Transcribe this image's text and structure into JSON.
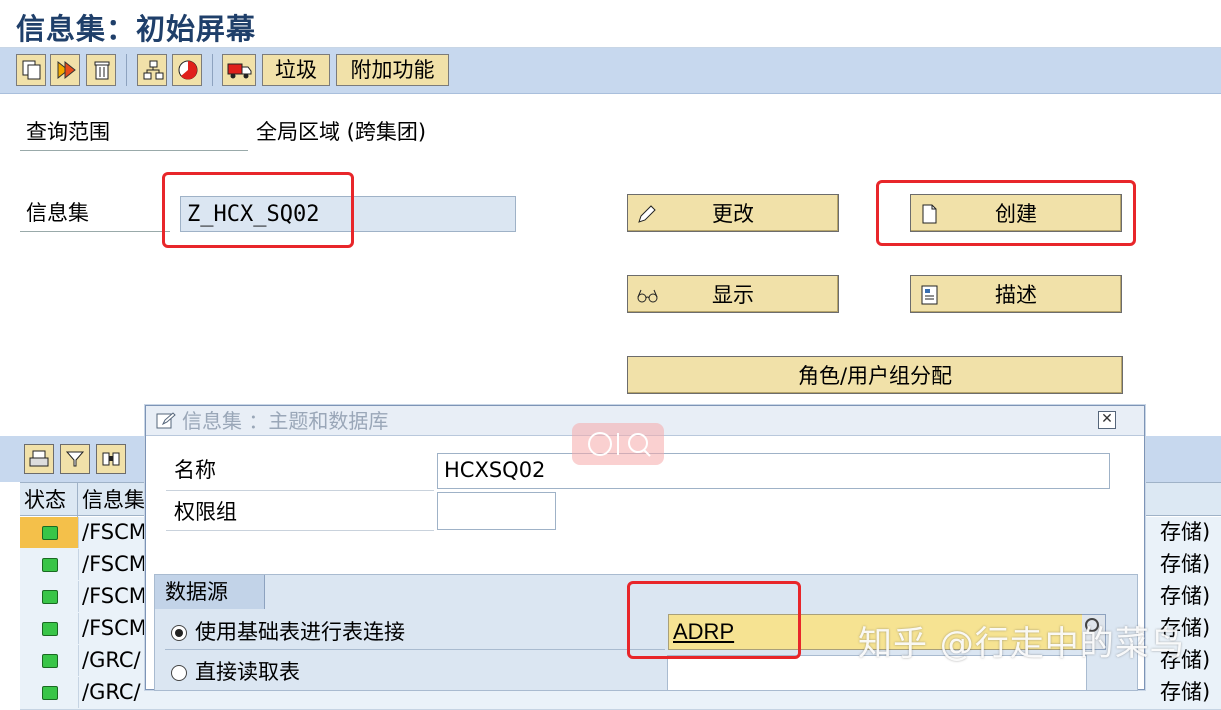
{
  "window": {
    "title": "信息集：初始屏幕"
  },
  "toolbar": {
    "trash_label": "垃圾",
    "extras_label": "附加功能"
  },
  "form": {
    "scope_label": "查询范围",
    "scope_value": "全局区域 (跨集团)",
    "infoset_label": "信息集",
    "infoset_value": "Z_HCX_SQ02"
  },
  "actions": {
    "change_label": "更改",
    "create_label": "创建",
    "display_label": "显示",
    "describe_label": "描述",
    "role_assign_label": "角色/用户组分配"
  },
  "list": {
    "headers": {
      "status": "状态",
      "infoset": "信息集"
    },
    "rows": [
      {
        "name": "/FSCM",
        "right": "存储)"
      },
      {
        "name": "/FSCM",
        "right": "存储)"
      },
      {
        "name": "/FSCM",
        "right": "存储)"
      },
      {
        "name": "/FSCM",
        "right": "存储)"
      },
      {
        "name": "/GRC/",
        "right": "存储)"
      },
      {
        "name": "/GRC/",
        "right": "存储)"
      }
    ]
  },
  "dialog": {
    "title": "信息集 ：主题和数据库",
    "name_label": "名称",
    "name_value": "HCXSQ02",
    "auth_group_label": "权限组",
    "auth_group_value": "",
    "datasource_label": "数据源",
    "radio_join_label": "使用基础表进行表连接",
    "radio_direct_label": "直接读取表",
    "table_value": "ADRP"
  },
  "watermark": "知乎 @行走中的菜鸟"
}
